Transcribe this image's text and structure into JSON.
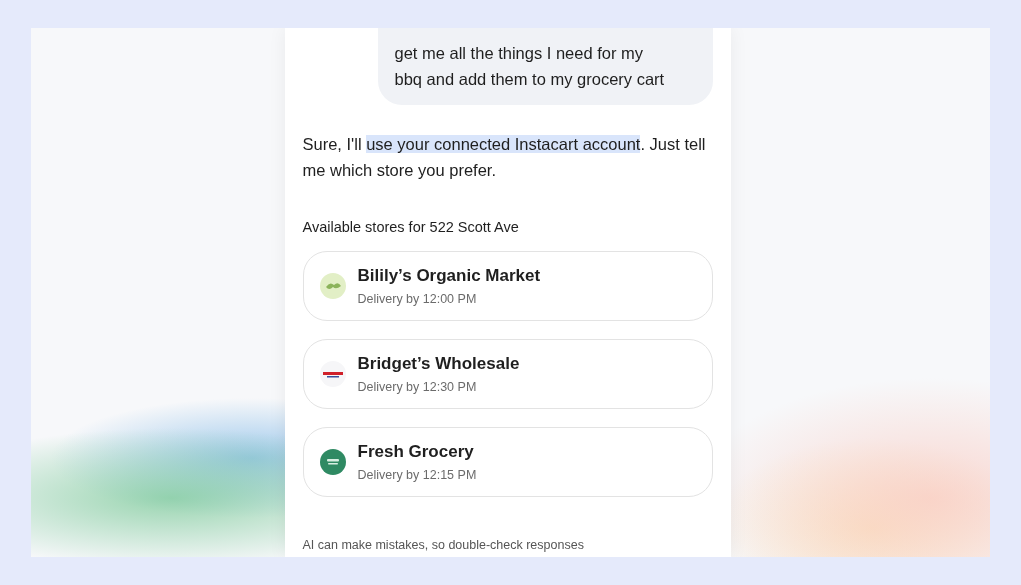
{
  "user_message": {
    "lines": [
      "get me all the things I need for my",
      "bbq and add them to my grocery cart"
    ]
  },
  "reply": {
    "before": "Sure, I'll ",
    "highlight": "use your connected Instacart account",
    "after": ". Just tell me which store you prefer."
  },
  "stores_heading": "Available stores for 522 Scott Ave",
  "stores": [
    {
      "name": "Bilily’s Organic Market",
      "delivery": "Delivery by 12:00 PM",
      "kind": "leaf"
    },
    {
      "name": "Bridget’s Wholesale",
      "delivery": "Delivery by 12:30 PM",
      "kind": "banner"
    },
    {
      "name": "Fresh Grocery",
      "delivery": "Delivery by 12:15 PM",
      "kind": "round"
    }
  ],
  "disclaimer": "AI can make mistakes, so double-check responses"
}
